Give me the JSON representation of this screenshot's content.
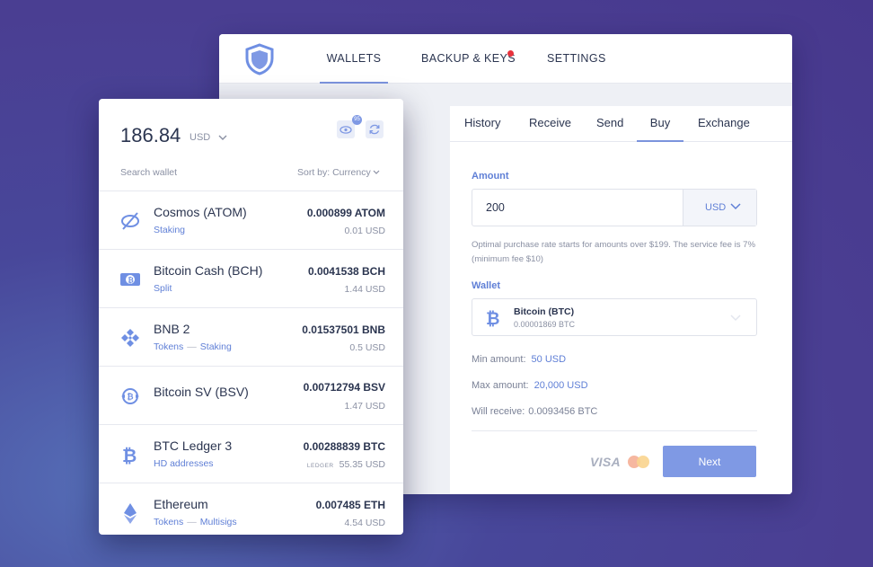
{
  "nav": {
    "items": [
      {
        "label": "WALLETS"
      },
      {
        "label": "BACKUP & KEYS"
      },
      {
        "label": "SETTINGS"
      }
    ]
  },
  "tabs": [
    {
      "label": "History"
    },
    {
      "label": "Receive"
    },
    {
      "label": "Send"
    },
    {
      "label": "Buy"
    },
    {
      "label": "Exchange"
    }
  ],
  "buy": {
    "amount_label": "Amount",
    "amount_value": "200",
    "currency": "USD",
    "note": "Optimal purchase rate starts for amounts over $199. The service fee is 7% (minimum fee $10)",
    "wallet_label": "Wallet",
    "wallet_name": "Bitcoin (BTC)",
    "wallet_amount": "0.00001869 BTC",
    "min_label": "Min amount:",
    "min_value": "50 USD",
    "max_label": "Max amount:",
    "max_value": "20,000 USD",
    "receive_label": "Will receive:",
    "receive_value": "0.0093456 BTC",
    "visa": "VISA",
    "next_label": "Next"
  },
  "sidebar": {
    "balance": "186.84",
    "balance_currency": "USD",
    "badge": "95",
    "search_placeholder": "Search wallet",
    "sort_label": "Sort by: Currency",
    "wallets": [
      {
        "name": "Cosmos (ATOM)",
        "tags": [
          "Staking"
        ],
        "balance": "0.000899 ATOM",
        "fiat": "0.01 USD",
        "icon": "cosmos-icon"
      },
      {
        "name": "Bitcoin Cash (BCH)",
        "tags": [
          "Split"
        ],
        "balance": "0.0041538 BCH",
        "fiat": "1.44 USD",
        "icon": "bitcoin-cash-icon"
      },
      {
        "name": "BNB 2",
        "tags": [
          "Tokens",
          "Staking"
        ],
        "balance": "0.01537501 BNB",
        "fiat": "0.5 USD",
        "icon": "bnb-icon"
      },
      {
        "name": "Bitcoin SV (BSV)",
        "tags": [],
        "balance": "0.00712794 BSV",
        "fiat": "1.47 USD",
        "icon": "bitcoin-sv-icon"
      },
      {
        "name": "BTC Ledger 3",
        "tags": [
          "HD addresses"
        ],
        "balance": "0.00288839 BTC",
        "fiat": "55.35 USD",
        "fiat_tag": "LEDGER",
        "icon": "bitcoin-icon"
      },
      {
        "name": "Ethereum",
        "tags": [
          "Tokens",
          "Multisigs"
        ],
        "balance": "0.007485 ETH",
        "fiat": "4.54 USD",
        "icon": "ethereum-icon"
      }
    ]
  },
  "colors": {
    "accent": "#7b93dd",
    "link": "#5f7fd6",
    "button": "#7f99e4",
    "notification_dot": "#e8323c"
  }
}
